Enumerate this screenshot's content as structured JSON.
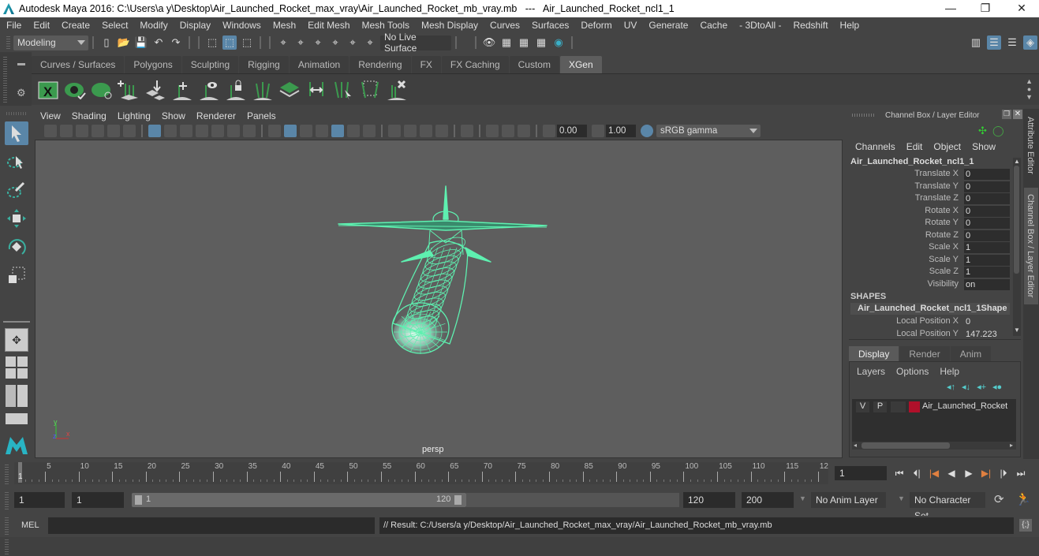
{
  "window": {
    "title": "Autodesk Maya 2016: C:\\Users\\a y\\Desktop\\Air_Launched_Rocket_max_vray\\Air_Launched_Rocket_mb_vray.mb   ---   Air_Launched_Rocket_ncl1_1",
    "minimize": "—",
    "maximize": "❐",
    "close": "✕"
  },
  "menubar": [
    "File",
    "Edit",
    "Create",
    "Select",
    "Modify",
    "Display",
    "Windows",
    "Mesh",
    "Edit Mesh",
    "Mesh Tools",
    "Mesh Display",
    "Curves",
    "Surfaces",
    "Deform",
    "UV",
    "Generate",
    "Cache",
    "- 3DtoAll -",
    "Redshift",
    "Help"
  ],
  "statusline": {
    "mode": "Modeling",
    "live_surface": "No Live Surface"
  },
  "shelf": {
    "tabs": [
      "Curves / Surfaces",
      "Polygons",
      "Sculpting",
      "Rigging",
      "Animation",
      "Rendering",
      "FX",
      "FX Caching",
      "Custom",
      "XGen"
    ],
    "active_tab": "XGen",
    "icons": [
      "xgen-editor-icon",
      "toggle-visibility-icon",
      "hide-primitives-icon",
      "add-guide-icon",
      "sculpt-guides-icon",
      "add-guides-icon",
      "select-guides-icon",
      "lock-guides-icon",
      "mirror-guides-icon",
      "create-patch-icon",
      "flip-guides-icon",
      "select-region-icon",
      "guide-shape-icon",
      "delete-guides-icon"
    ]
  },
  "viewport": {
    "menu": [
      "View",
      "Shading",
      "Lighting",
      "Show",
      "Renderer",
      "Panels"
    ],
    "exposure": "0.00",
    "gamma": "1.00",
    "color_space": "sRGB gamma",
    "camera_label": "persp",
    "axis": {
      "x": "x",
      "y": "y",
      "z": "z"
    },
    "wire_color": "#5ef0b0"
  },
  "channel_box": {
    "title": "Channel Box / Layer Editor",
    "menu": [
      "Channels",
      "Edit",
      "Object",
      "Show"
    ],
    "object_name": "Air_Launched_Rocket_ncl1_1",
    "channels": [
      {
        "label": "Translate X",
        "value": "0"
      },
      {
        "label": "Translate Y",
        "value": "0"
      },
      {
        "label": "Translate Z",
        "value": "0"
      },
      {
        "label": "Rotate X",
        "value": "0"
      },
      {
        "label": "Rotate Y",
        "value": "0"
      },
      {
        "label": "Rotate Z",
        "value": "0"
      },
      {
        "label": "Scale X",
        "value": "1"
      },
      {
        "label": "Scale Y",
        "value": "1"
      },
      {
        "label": "Scale Z",
        "value": "1"
      },
      {
        "label": "Visibility",
        "value": "on"
      }
    ],
    "shapes_header": "SHAPES",
    "shape_name": "Air_Launched_Rocket_ncl1_1Shape",
    "shape_channels": [
      {
        "label": "Local Position X",
        "value": "0"
      },
      {
        "label": "Local Position Y",
        "value": "147.223"
      }
    ],
    "side_tabs": [
      "Attribute Editor",
      "Channel Box / Layer Editor"
    ]
  },
  "layer_editor": {
    "tabs": [
      "Display",
      "Render",
      "Anim"
    ],
    "active_tab": "Display",
    "menu": [
      "Layers",
      "Options",
      "Help"
    ],
    "layers": [
      {
        "v": "V",
        "p": "P",
        "color": "#b0102a",
        "name": "Air_Launched_Rocket"
      }
    ]
  },
  "timeline": {
    "ticks": [
      "5",
      "10",
      "15",
      "20",
      "25",
      "30",
      "35",
      "40",
      "45",
      "50",
      "55",
      "60",
      "65",
      "70",
      "75",
      "80",
      "85",
      "90",
      "95",
      "100",
      "105",
      "110",
      "115",
      "12"
    ],
    "current_frame_marker": "1",
    "current_frame": "1"
  },
  "range": {
    "start": "1",
    "playback_start": "1",
    "slider_start": "1",
    "slider_end": "120",
    "playback_end": "120",
    "end": "200",
    "anim_layer": "No Anim Layer",
    "character_set": "No Character Set"
  },
  "command": {
    "language": "MEL",
    "input": "",
    "result": "// Result: C:/Users/a y/Desktop/Air_Launched_Rocket_max_vray/Air_Launched_Rocket_mb_vray.mb"
  }
}
